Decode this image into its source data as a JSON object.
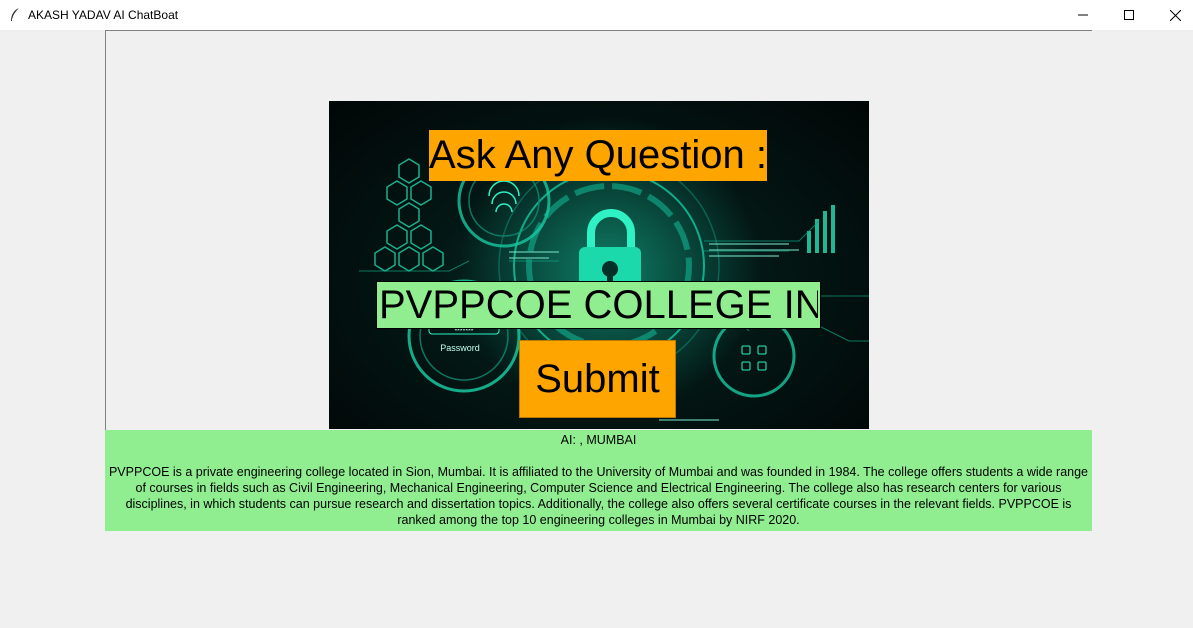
{
  "window": {
    "title": "AKASH YADAV AI ChatBoat",
    "app_icon": "feather-icon",
    "controls": [
      "minimize-icon",
      "maximize-icon",
      "close-icon"
    ]
  },
  "main": {
    "ask_label": "Ask Any Question :",
    "question_input": {
      "value": "PVPPCOE COLLEGE IN"
    },
    "submit_label": "Submit",
    "hero_image": {
      "description_icon": "cybersecurity-padlock-image",
      "password_text": "Password",
      "password_mask": "*******"
    }
  },
  "answer": {
    "heading": "AI: , MUMBAI",
    "body": "PVPPCOE is a private engineering college located in Sion, Mumbai. It is affiliated to the University of Mumbai and was founded in 1984. The college offers students a wide range of courses in fields such as Civil Engineering, Mechanical Engineering, Computer Science and Electrical Engineering. The college also has research centers for various disciplines, in which students can pursue research and dissertation topics. Additionally, the college also offers several certificate courses in the relevant fields. PVPPCOE is ranked among the top 10 engineering colleges in Mumbai by NIRF 2020."
  },
  "colors": {
    "orange": "#ffa500",
    "light_green": "#90ee90",
    "window_bg": "#f0f0f0"
  }
}
